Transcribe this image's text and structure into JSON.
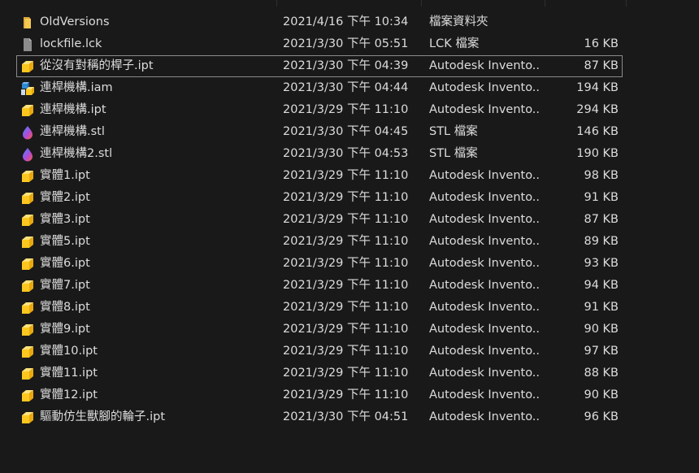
{
  "files": [
    {
      "name": "OldVersions",
      "date": "2021/4/16 下午 10:34",
      "type": "檔案資料夾",
      "size": "",
      "icon": "folder-icon",
      "selected": false
    },
    {
      "name": "lockfile.lck",
      "date": "2021/3/30 下午 05:51",
      "type": "LCK 檔案",
      "size": "16 KB",
      "icon": "generic-file-icon",
      "selected": false
    },
    {
      "name": "從沒有對稱的桿子.ipt",
      "date": "2021/3/30 下午 04:39",
      "type": "Autodesk Invento...",
      "size": "87 KB",
      "icon": "inventor-part-icon",
      "selected": true
    },
    {
      "name": "連桿機構.iam",
      "date": "2021/3/30 下午 04:44",
      "type": "Autodesk Invento...",
      "size": "194 KB",
      "icon": "inventor-assembly-icon",
      "selected": false
    },
    {
      "name": "連桿機構.ipt",
      "date": "2021/3/29 下午 11:10",
      "type": "Autodesk Invento...",
      "size": "294 KB",
      "icon": "inventor-part-icon",
      "selected": false
    },
    {
      "name": "連桿機構.stl",
      "date": "2021/3/30 下午 04:45",
      "type": "STL 檔案",
      "size": "146 KB",
      "icon": "stl-file-icon",
      "selected": false
    },
    {
      "name": "連桿機構2.stl",
      "date": "2021/3/30 下午 04:53",
      "type": "STL 檔案",
      "size": "190 KB",
      "icon": "stl-file-icon",
      "selected": false
    },
    {
      "name": "實體1.ipt",
      "date": "2021/3/29 下午 11:10",
      "type": "Autodesk Invento...",
      "size": "98 KB",
      "icon": "inventor-part-icon",
      "selected": false
    },
    {
      "name": "實體2.ipt",
      "date": "2021/3/29 下午 11:10",
      "type": "Autodesk Invento...",
      "size": "91 KB",
      "icon": "inventor-part-icon",
      "selected": false
    },
    {
      "name": "實體3.ipt",
      "date": "2021/3/29 下午 11:10",
      "type": "Autodesk Invento...",
      "size": "87 KB",
      "icon": "inventor-part-icon",
      "selected": false
    },
    {
      "name": "實體5.ipt",
      "date": "2021/3/29 下午 11:10",
      "type": "Autodesk Invento...",
      "size": "89 KB",
      "icon": "inventor-part-icon",
      "selected": false
    },
    {
      "name": "實體6.ipt",
      "date": "2021/3/29 下午 11:10",
      "type": "Autodesk Invento...",
      "size": "93 KB",
      "icon": "inventor-part-icon",
      "selected": false
    },
    {
      "name": "實體7.ipt",
      "date": "2021/3/29 下午 11:10",
      "type": "Autodesk Invento...",
      "size": "94 KB",
      "icon": "inventor-part-icon",
      "selected": false
    },
    {
      "name": "實體8.ipt",
      "date": "2021/3/29 下午 11:10",
      "type": "Autodesk Invento...",
      "size": "91 KB",
      "icon": "inventor-part-icon",
      "selected": false
    },
    {
      "name": "實體9.ipt",
      "date": "2021/3/29 下午 11:10",
      "type": "Autodesk Invento...",
      "size": "90 KB",
      "icon": "inventor-part-icon",
      "selected": false
    },
    {
      "name": "實體10.ipt",
      "date": "2021/3/29 下午 11:10",
      "type": "Autodesk Invento...",
      "size": "97 KB",
      "icon": "inventor-part-icon",
      "selected": false
    },
    {
      "name": "實體11.ipt",
      "date": "2021/3/29 下午 11:10",
      "type": "Autodesk Invento...",
      "size": "88 KB",
      "icon": "inventor-part-icon",
      "selected": false
    },
    {
      "name": "實體12.ipt",
      "date": "2021/3/29 下午 11:10",
      "type": "Autodesk Invento...",
      "size": "90 KB",
      "icon": "inventor-part-icon",
      "selected": false
    },
    {
      "name": "驅動仿生獸腳的輪子.ipt",
      "date": "2021/3/30 下午 04:51",
      "type": "Autodesk Invento...",
      "size": "96 KB",
      "icon": "inventor-part-icon",
      "selected": false
    }
  ]
}
